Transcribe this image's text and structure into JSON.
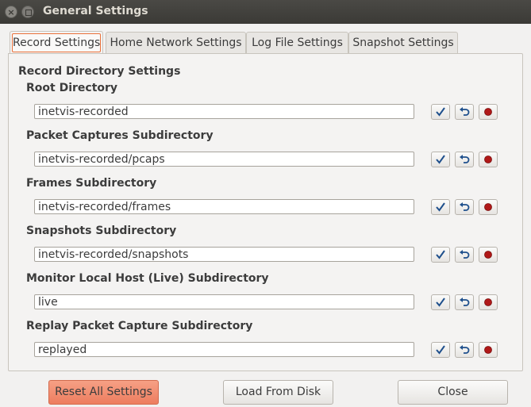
{
  "window": {
    "title": "General Settings"
  },
  "tabs": [
    {
      "label": "Record Settings"
    },
    {
      "label": "Home Network Settings"
    },
    {
      "label": "Log File Settings"
    },
    {
      "label": "Snapshot Settings"
    }
  ],
  "section": {
    "title": "Record Directory Settings"
  },
  "rows": [
    {
      "label": "Root Directory",
      "value": "inetvis-recorded"
    },
    {
      "label": "Packet Captures Subdirectory",
      "value": "inetvis-recorded/pcaps"
    },
    {
      "label": "Frames Subdirectory",
      "value": "inetvis-recorded/frames"
    },
    {
      "label": "Snapshots Subdirectory",
      "value": "inetvis-recorded/snapshots"
    },
    {
      "label": "Monitor Local Host (Live) Subdirectory",
      "value": "live"
    },
    {
      "label": "Replay Packet Capture Subdirectory",
      "value": "replayed"
    }
  ],
  "row_icons": {
    "apply": "checkmark-icon",
    "undo": "undo-icon",
    "record": "record-dot-icon"
  },
  "colors": {
    "accent": "#e9703a",
    "record_dot": "#b01818",
    "icon_blue": "#1e4f8c"
  },
  "buttons": {
    "reset": "Reset All Settings",
    "load": "Load From Disk",
    "close": "Close"
  }
}
